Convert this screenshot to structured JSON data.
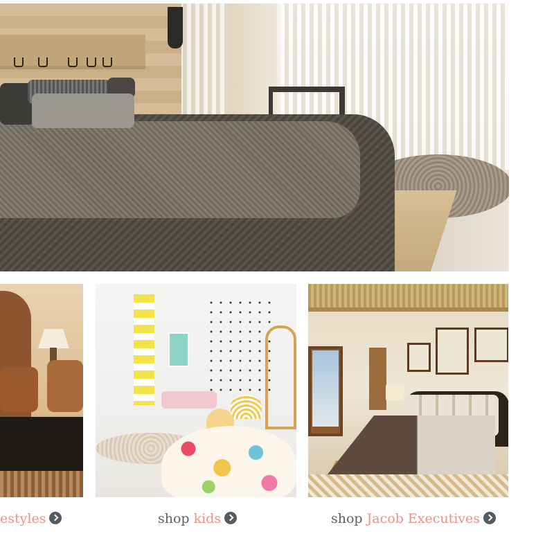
{
  "hero": {
    "image": "bedroom-photo"
  },
  "tiles": [
    {
      "image": "living-room-photo",
      "caption_prefix": "",
      "caption_accent": "estyles"
    },
    {
      "image": "kids-room-photo",
      "caption_prefix": "shop ",
      "caption_accent": "kids"
    },
    {
      "image": "executive-bedroom-photo",
      "caption_prefix": "shop ",
      "caption_accent": "Jacob Executives"
    }
  ],
  "colors": {
    "caption_text": "#5a6068",
    "caption_accent": "#e99286",
    "arrow_icon": "#555b62"
  },
  "icons": {
    "caption_arrow": "chevron-circle-right-icon"
  }
}
